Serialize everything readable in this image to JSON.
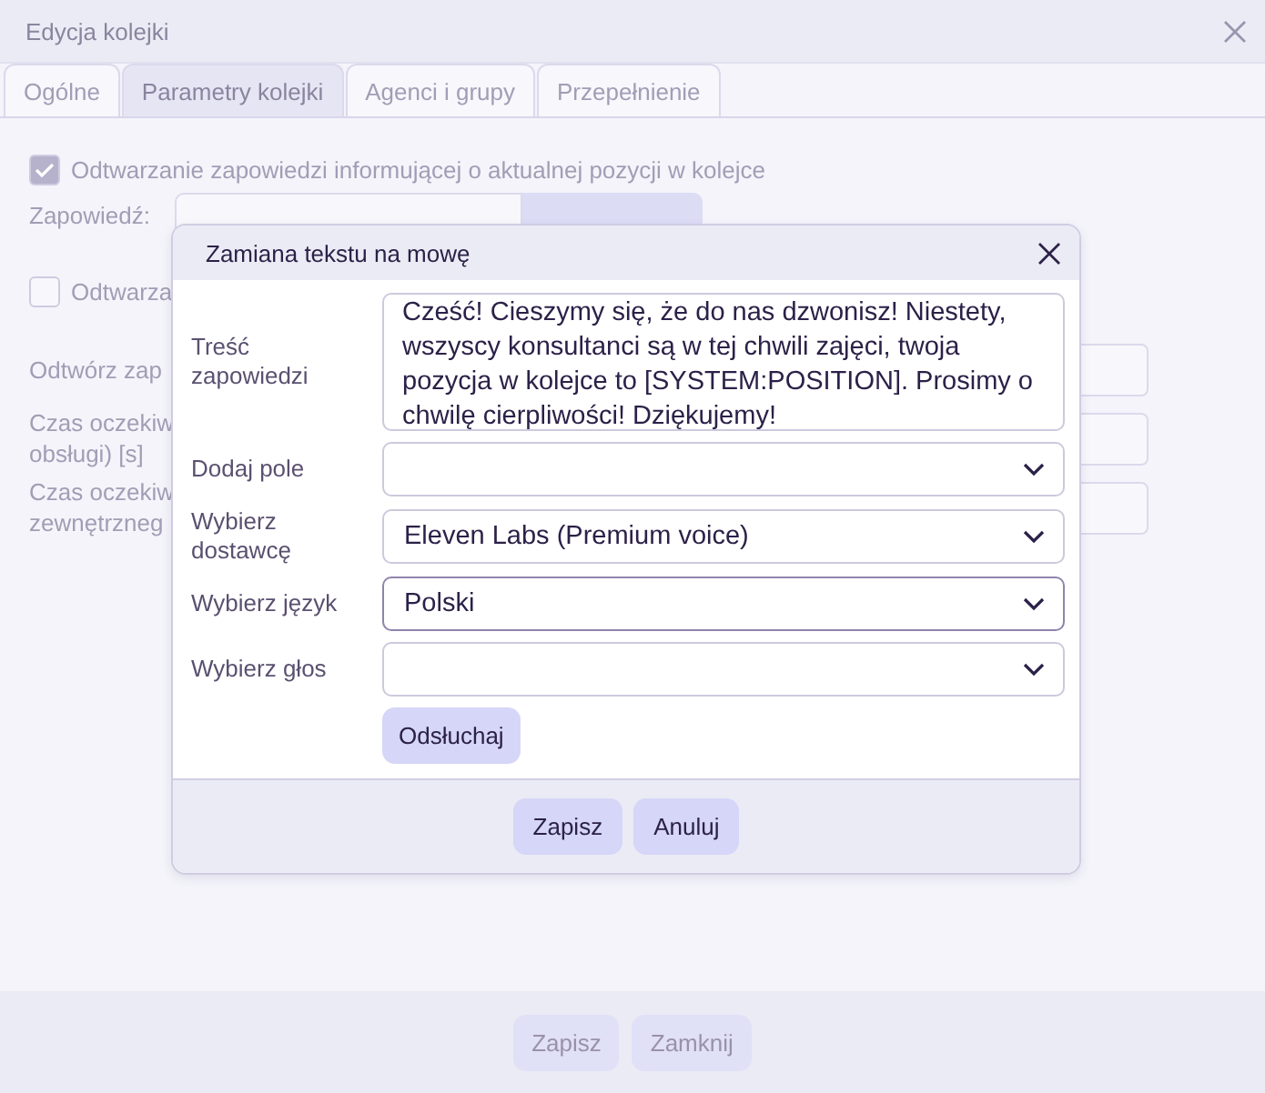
{
  "window": {
    "title": "Edycja kolejki"
  },
  "tabs": [
    {
      "label": "Ogólne",
      "selected": false
    },
    {
      "label": "Parametry kolejki",
      "selected": true
    },
    {
      "label": "Agenci i grupy",
      "selected": false
    },
    {
      "label": "Przepełnienie",
      "selected": false
    }
  ],
  "announcement_option": {
    "label": "Odtwarzanie zapowiedzi informującej o aktualnej pozycji w kolejce",
    "checked": true
  },
  "announcement": {
    "label": "Zapowiedź:"
  },
  "second_option": {
    "label": "Odtwarza",
    "checked": false
  },
  "rows": [
    {
      "label": "Odtwórz zap"
    },
    {
      "label": "Czas oczekiw\nobsługi) [s]"
    },
    {
      "label": "Czas oczekiw\nzewnętrzneg"
    }
  ],
  "footer_buttons": [
    "Zapisz",
    "Zamknij"
  ],
  "dialog": {
    "title": "Zamiana tekstu na mowę",
    "fields": [
      {
        "kind": "textarea",
        "label": "Treść zapowiedzi",
        "value": "Cześć! Cieszymy się, że do nas dzwonisz! Niestety, wszyscy konsultanci są w tej chwili zajęci, twoja pozycja w kolejce to [SYSTEM:POSITION]. Prosimy o chwilę cierpliwości! Dziękujemy!"
      },
      {
        "kind": "select",
        "label": "Dodaj pole",
        "focused": false
      },
      {
        "kind": "select",
        "label": "Wybierz dostawcę",
        "value": "Eleven Labs (Premium voice)",
        "focused": false
      },
      {
        "kind": "select",
        "label": "Wybierz język",
        "value": "Polski",
        "focused": true
      },
      {
        "kind": "select",
        "label": "Wybierz głos",
        "focused": false
      }
    ],
    "listen_button": "Odsłuchaj",
    "buttons": [
      "Zapisz",
      "Anuluj"
    ]
  }
}
